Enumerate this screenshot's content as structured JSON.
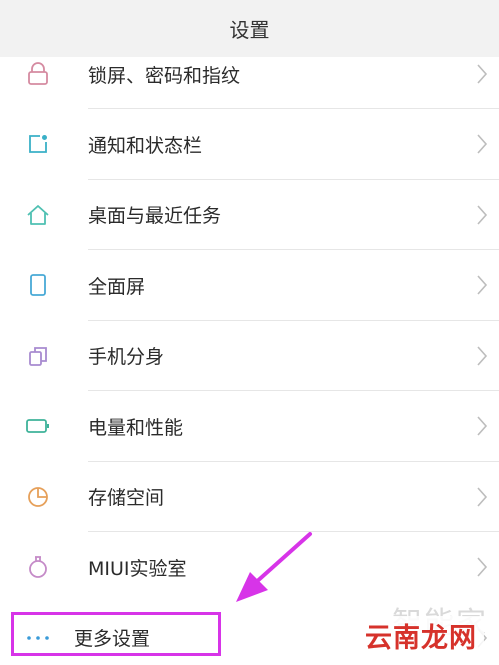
{
  "header": {
    "title": "设置"
  },
  "items": [
    {
      "label": "锁屏、密码和指纹",
      "icon": "lock-icon",
      "color": "#d58ba1"
    },
    {
      "label": "通知和状态栏",
      "icon": "notification-icon",
      "color": "#3ab0c7"
    },
    {
      "label": "桌面与最近任务",
      "icon": "home-icon",
      "color": "#4fc0b2"
    },
    {
      "label": "全面屏",
      "icon": "phone-icon",
      "color": "#48a9d6"
    },
    {
      "label": "手机分身",
      "icon": "clone-icon",
      "color": "#a88bd0"
    },
    {
      "label": "电量和性能",
      "icon": "battery-icon",
      "color": "#3fb39a"
    },
    {
      "label": "存储空间",
      "icon": "storage-icon",
      "color": "#e6a05a"
    },
    {
      "label": "MIUI实验室",
      "icon": "flask-icon",
      "color": "#c58bc8"
    },
    {
      "label": "更多设置",
      "icon": "more-icon",
      "color": "#3a9bd8"
    }
  ],
  "highlight_color": "#d734e8",
  "watermark": {
    "top": "智能家",
    "text": "云南龙网"
  }
}
